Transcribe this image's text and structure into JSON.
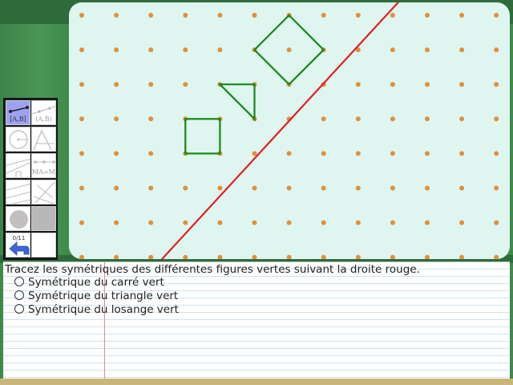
{
  "colors": {
    "board_bg": "#dff5f0",
    "dot": "#e0903a",
    "mirror_line": "#e02020",
    "shapes": "#128a12"
  },
  "toolbox": {
    "tools": [
      {
        "id": "segment",
        "label": "[A,B]",
        "icon": "segment-icon",
        "active": true
      },
      {
        "id": "line",
        "label": "(A,B)",
        "icon": "line-icon",
        "active": false
      },
      {
        "id": "circle",
        "label": "",
        "icon": "circle-icon",
        "active": false
      },
      {
        "id": "compass",
        "label": "",
        "icon": "compass-icon",
        "active": false
      },
      {
        "id": "perpendicular",
        "label": "",
        "icon": "perpendicular-icon",
        "active": false
      },
      {
        "id": "midpoint",
        "label": "MA=MB",
        "icon": "midpoint-icon",
        "active": false
      },
      {
        "id": "parallel",
        "label": "",
        "icon": "parallel-icon",
        "active": false
      },
      {
        "id": "angle",
        "label": "",
        "icon": "angle-icon",
        "active": false
      },
      {
        "id": "fill",
        "label": "",
        "icon": "gray-disc-icon",
        "active": false
      },
      {
        "id": "gray",
        "label": "",
        "icon": "gray-square-icon",
        "active": false
      }
    ],
    "counter": "0/11",
    "undo_icon": "undo-arrow-icon"
  },
  "notebook": {
    "instruction": "Tracez les symétriques des différentes figures vertes suivant la droite rouge.",
    "tasks": [
      {
        "label": "Symétrique du carré vert"
      },
      {
        "label": "Symétrique du triangle vert"
      },
      {
        "label": "Symétrique du losange vert"
      }
    ]
  }
}
